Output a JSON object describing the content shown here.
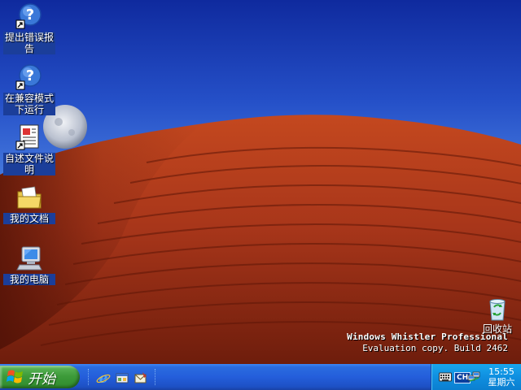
{
  "desktop": {
    "icons": [
      {
        "label": "提出错误报告",
        "icon": "help-shortcut-icon"
      },
      {
        "label": "在兼容模式下运行",
        "icon": "help-shortcut-icon"
      },
      {
        "label": "自述文件说明",
        "icon": "document-shortcut-icon"
      },
      {
        "label": "我的文档",
        "icon": "my-documents-icon"
      },
      {
        "label": "我的电脑",
        "icon": "my-computer-icon"
      }
    ],
    "recycle_bin": {
      "label": "回收站",
      "icon": "recycle-bin-icon"
    },
    "build_line1": "Windows Whistler Professional",
    "build_line2": "Evaluation copy. Build 2462"
  },
  "taskbar": {
    "start_label": "开始",
    "quick_launch": [
      "internet-explorer-icon",
      "show-desktop-icon",
      "outlook-express-icon"
    ],
    "tray": {
      "language": "CH",
      "time": "15:55",
      "day": "星期六"
    }
  },
  "colors": {
    "taskbar": "#245edb",
    "start": "#3d9b3a",
    "tray": "#0f8fe0",
    "sand": "#b0361a"
  }
}
